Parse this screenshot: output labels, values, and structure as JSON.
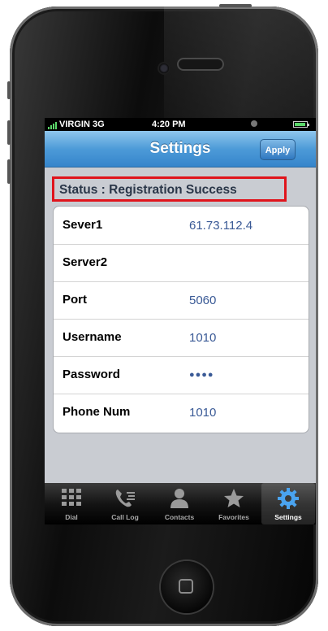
{
  "status_bar": {
    "carrier": "VIRGIN 3G",
    "time": "4:20 PM"
  },
  "nav": {
    "title": "Settings",
    "apply_label": "Apply"
  },
  "status": {
    "text": "Status : Registration Success",
    "highlight_color": "#e0141c"
  },
  "settings": [
    {
      "label": "Sever1",
      "value": "61.73.112.4"
    },
    {
      "label": "Server2",
      "value": ""
    },
    {
      "label": "Port",
      "value": "5060"
    },
    {
      "label": "Username",
      "value": "1010"
    },
    {
      "label": "Password",
      "value": "●●●●"
    },
    {
      "label": "Phone Num",
      "value": "1010"
    }
  ],
  "tabs": [
    {
      "label": "Dial",
      "icon": "dialpad-icon"
    },
    {
      "label": "Call Log",
      "icon": "call-log-icon"
    },
    {
      "label": "Contacts",
      "icon": "contacts-icon"
    },
    {
      "label": "Favorites",
      "icon": "star-icon"
    },
    {
      "label": "Settings",
      "icon": "gear-icon",
      "selected": true
    }
  ]
}
